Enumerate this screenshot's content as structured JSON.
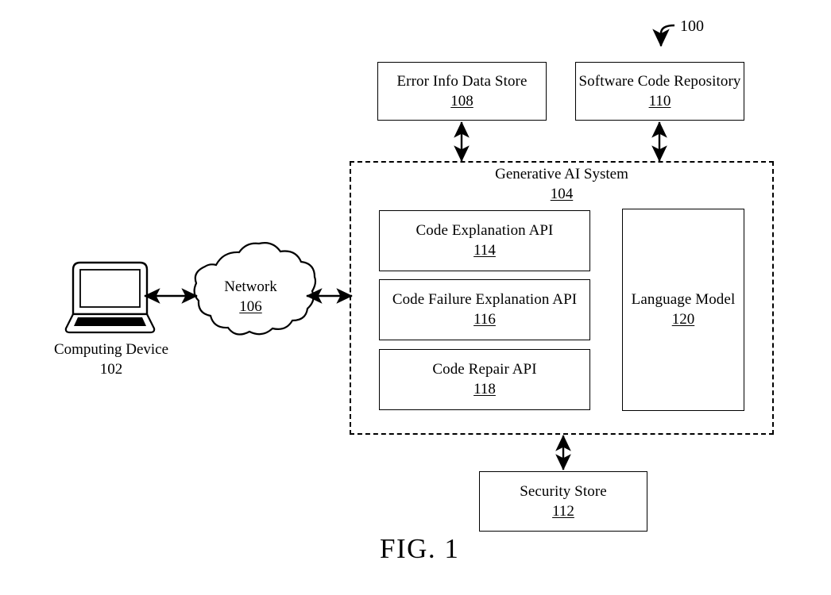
{
  "figure": {
    "caption": "FIG. 1",
    "overall_ref": "100"
  },
  "nodes": {
    "error_info_data_store": {
      "label": "Error Info Data Store",
      "ref": "108",
      "shape": "rectangle"
    },
    "software_code_repository": {
      "label": "Software Code Repository",
      "ref": "110",
      "shape": "rectangle"
    },
    "generative_ai_system": {
      "label": "Generative AI System",
      "ref": "104",
      "shape": "dashed-container"
    },
    "code_explanation_api": {
      "label": "Code Explanation API",
      "ref": "114",
      "shape": "rectangle"
    },
    "code_failure_explanation_api": {
      "label": "Code Failure Explanation API",
      "ref": "116",
      "shape": "rectangle"
    },
    "code_repair_api": {
      "label": "Code Repair API",
      "ref": "118",
      "shape": "rectangle"
    },
    "language_model": {
      "label": "Language Model",
      "ref": "120",
      "shape": "rectangle"
    },
    "security_store": {
      "label": "Security Store",
      "ref": "112",
      "shape": "rectangle"
    },
    "network": {
      "label": "Network",
      "ref": "106",
      "shape": "cloud"
    },
    "computing_device": {
      "label": "Computing Device",
      "ref": "102",
      "shape": "laptop-icon",
      "ref_underlined": false
    }
  },
  "connections": [
    {
      "from": "computing_device",
      "to": "network",
      "style": "double-arrow",
      "orientation": "horizontal"
    },
    {
      "from": "network",
      "to": "generative_ai_system",
      "style": "double-arrow",
      "orientation": "horizontal"
    },
    {
      "from": "error_info_data_store",
      "to": "generative_ai_system",
      "style": "double-arrow",
      "orientation": "vertical"
    },
    {
      "from": "software_code_repository",
      "to": "generative_ai_system",
      "style": "double-arrow",
      "orientation": "vertical"
    },
    {
      "from": "generative_ai_system",
      "to": "security_store",
      "style": "double-arrow",
      "orientation": "vertical"
    }
  ],
  "colors": {
    "stroke": "#000000",
    "background": "#ffffff"
  }
}
